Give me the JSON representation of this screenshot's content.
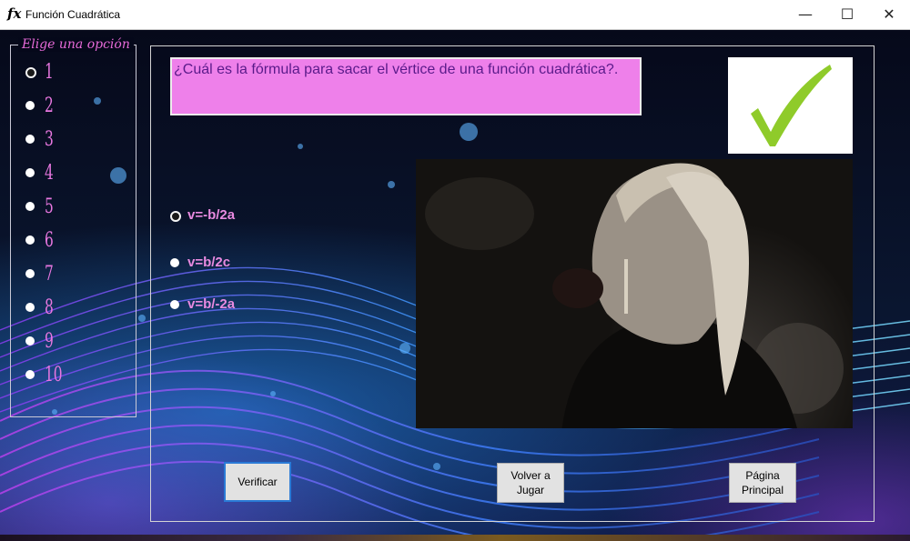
{
  "window": {
    "title": "Función Cuadrática",
    "app_icon": "fx",
    "minimize": "—",
    "maximize": "☐",
    "close": "✕"
  },
  "sidebar": {
    "legend": "Elige una opción",
    "items": [
      "1",
      "2",
      "3",
      "4",
      "5",
      "6",
      "7",
      "8",
      "9",
      "10"
    ],
    "selected": "1"
  },
  "question": {
    "text": "¿Cuál es la fórmula para sacar el vértice de una función cuadrática?."
  },
  "result_icon": "checkmark-icon",
  "answers": {
    "options": [
      "v=-b/2a",
      "v=b/2c",
      "v=b/-2a"
    ],
    "selected": "v=-b/2a"
  },
  "buttons": {
    "verify": "Verificar",
    "play_again_1": "Volver a",
    "play_again_2": "Jugar",
    "home_1": "Página",
    "home_2": "Principal"
  },
  "colors": {
    "accent_pink": "#e877e0",
    "question_bg": "#ee80ea",
    "check_green": "#8fcb2a"
  }
}
